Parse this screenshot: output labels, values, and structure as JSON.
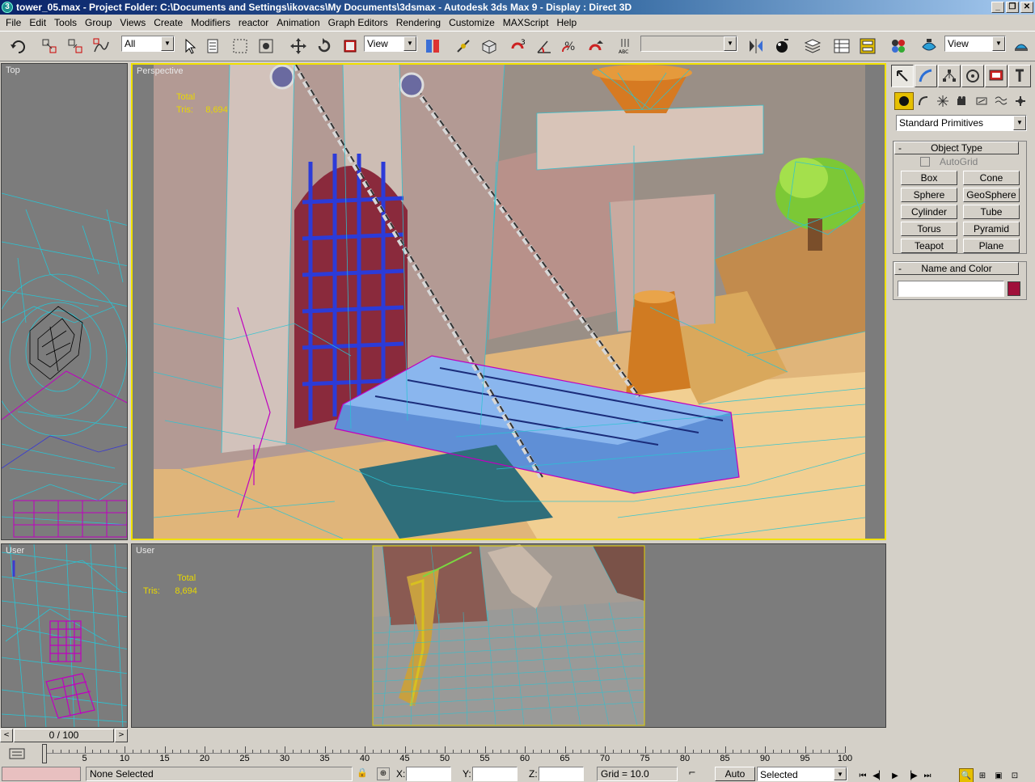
{
  "window": {
    "title": "tower_05.max    - Project Folder: C:\\Documents and Settings\\ikovacs\\My Documents\\3dsmax    - Autodesk 3ds Max 9     - Display : Direct 3D",
    "app_icon": "3ds-max-icon",
    "buttons": [
      "_",
      "❐",
      "✕"
    ]
  },
  "menu": [
    "File",
    "Edit",
    "Tools",
    "Group",
    "Views",
    "Create",
    "Modifiers",
    "reactor",
    "Animation",
    "Graph Editors",
    "Rendering",
    "Customize",
    "MAXScript",
    "Help"
  ],
  "toolbar": {
    "selection_filter": "All",
    "ref_coord": "View",
    "named_selection": "",
    "render_type": "View"
  },
  "viewports": {
    "top": {
      "label": "Top"
    },
    "perspective": {
      "label": "Perspective",
      "stats_total": "Total",
      "stats_tris_label": "Tris:",
      "stats_tris_value": "8,694"
    },
    "user_left": {
      "label": "User"
    },
    "user_main": {
      "label": "User",
      "stats_total": "Total",
      "stats_tris_label": "Tris:",
      "stats_tris_value": "8,694"
    }
  },
  "command_panel": {
    "category": "Standard Primitives",
    "object_type_title": "Object Type",
    "autogrid_label": "AutoGrid",
    "primitives": [
      "Box",
      "Cone",
      "Sphere",
      "GeoSphere",
      "Cylinder",
      "Tube",
      "Torus",
      "Pyramid",
      "Teapot",
      "Plane"
    ],
    "name_color_title": "Name and Color",
    "name_value": "",
    "color": "#a0103a"
  },
  "timeline": {
    "frame_display": "0 / 100",
    "ticks": [
      "0",
      "5",
      "10",
      "15",
      "20",
      "25",
      "30",
      "35",
      "40",
      "45",
      "50",
      "55",
      "60",
      "65",
      "70",
      "75",
      "80",
      "85",
      "90",
      "95",
      "100"
    ]
  },
  "status": {
    "selection": "None Selected",
    "x_label": "X:",
    "y_label": "Y:",
    "z_label": "Z:",
    "grid": "Grid = 10.0",
    "auto_key": "Auto Key",
    "key_filter": "Selected"
  },
  "colors": {
    "title_start": "#0a246a",
    "active_border": "#f0e000",
    "wire_cyan": "#29c4d4",
    "wire_magenta": "#c000c0",
    "viewport_bg": "#7c7c7c"
  }
}
